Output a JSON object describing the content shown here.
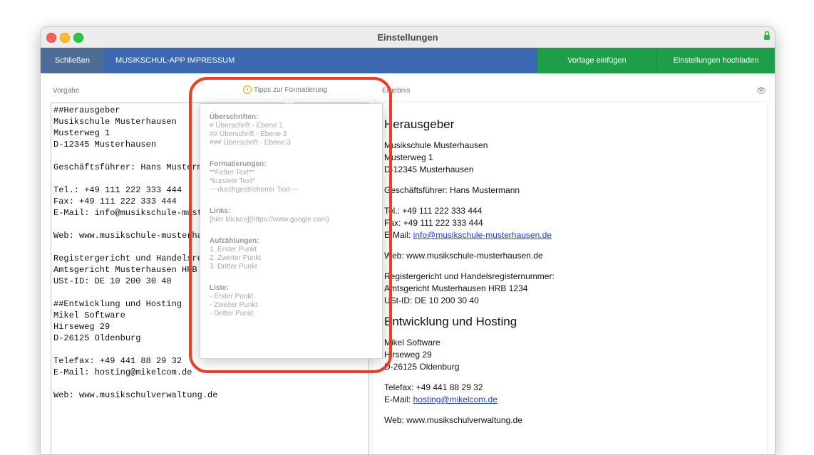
{
  "window": {
    "title": "Einstellungen"
  },
  "toolbar": {
    "close_label": "Schließen",
    "title": "MUSIKSCHUL-APP IMPRESSUM",
    "insert_template_label": "Vorlage einfügen",
    "upload_label": "Einstellungen hochladen"
  },
  "labels": {
    "source": "Vorgabe",
    "tips": "Tipps zur Formatierung",
    "result": "Ergebnis"
  },
  "editor": {
    "text": "##Herausgeber\nMusikschule Musterhausen\nMusterweg 1\nD-12345 Musterhausen\n\nGeschäftsführer: Hans Mustermann\n\nTel.: +49 111 222 333 444\nFax: +49 111 222 333 444\nE-Mail: info@musikschule-musterhausen.de\n\nWeb: www.musikschule-musterhausen.de\n\nRegistergericht und Handelsregisternummer:\nAmtsgericht Musterhausen HRB 1234\nUSt-ID: DE 10 200 30 40\n\n##Entwicklung und Hosting\nMikel Software\nHirseweg 29\nD-26125 Oldenburg\n\nTelefax: +49 441 88 29 32\nE-Mail: hosting@mikelcom.de\n\nWeb: www.musikschulverwaltung.de"
  },
  "result": {
    "heading1": "Herausgeber",
    "addr1": "Musikschule Musterhausen",
    "addr2": "Musterweg 1",
    "addr3": "D-12345 Musterhausen",
    "ceo": "Geschäftsführer: Hans Mustermann",
    "tel": "Tel.: +49 111 222 333 444",
    "fax": "Fax: +49 111 222 333 444",
    "email_prefix": "E-Mail: ",
    "email_link": "info@musikschule-musterhausen.de",
    "web": "Web: www.musikschule-musterhausen.de",
    "reg1": "Registergericht und Handelsregisternummer:",
    "reg2": "Amtsgericht Musterhausen HRB 1234",
    "reg3": "USt-ID: DE 10 200 30 40",
    "heading2": "Entwicklung und Hosting",
    "dev1": "Mikel Software",
    "dev2": "Hirseweg 29",
    "dev3": "D-26125 Oldenburg",
    "telefax": "Telefax: +49 441 88 29 32",
    "email2_prefix": "E-Mail: ",
    "email2_link": "hosting@mikelcom.de",
    "web2": "Web: www.musikschulverwaltung.de"
  },
  "tips_popover": {
    "headings_title": "Überschriften:",
    "h1": "# Überschrift - Ebene 1",
    "h2": "## Überschrift - Ebene 2",
    "h3": "### Überschrift - Ebene 3",
    "format_title": "Formatierungen:",
    "bold": "**Fetter Text**",
    "italic": "*kursiver Text*",
    "strike": "~~durchgestrichener Text~~",
    "links_title": "Links:",
    "link": "[hier klicken](https://www.google.com)",
    "enum_title": "Aufzählungen:",
    "enum1": "1. Erster Punkt",
    "enum2": "2. Zweiter Punkt",
    "enum3": "3. Dritter Punkt",
    "list_title": "Liste:",
    "list1": "- Erster Punkt",
    "list2": "- Zweiter Punkt",
    "list3": "- Dritter Punkt"
  },
  "colors": {
    "toolbar_blue": "#3b68b0",
    "close_button": "#4d6c96",
    "green_button": "#1e9e48",
    "highlight": "#f23a24",
    "link": "#1a3fd6"
  },
  "icons": [
    "close-dot",
    "minimize-dot",
    "zoom-dot",
    "lock-icon",
    "info-icon",
    "eye-icon"
  ]
}
